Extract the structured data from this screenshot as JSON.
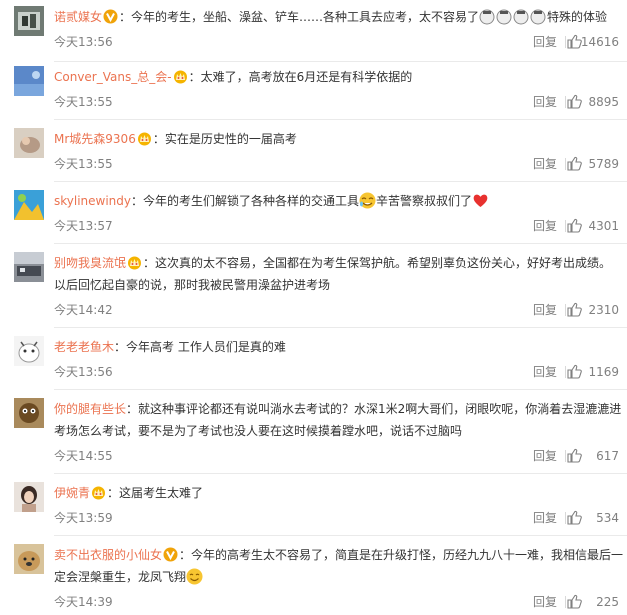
{
  "comments": [
    {
      "username": "诺贰媒女",
      "badge": "v-gold",
      "text": "今年的考生，坐船、澡盆、铲车……各种工具去应考，太不容易了",
      "emoji_text": "特殊的体验",
      "time": "今天13:56",
      "reply_label": "回复",
      "likes": "14616"
    },
    {
      "username": "Conver_Vans_总_会-",
      "badge": "crown",
      "text": "太难了，高考放在6月还是有科学依据的",
      "time": "今天13:55",
      "reply_label": "回复",
      "likes": "8895"
    },
    {
      "username": "Mr城先森9306",
      "badge": "crown",
      "text": "实在是历史性的一届高考",
      "time": "今天13:55",
      "reply_label": "回复",
      "likes": "5789"
    },
    {
      "username": "skylinewindy",
      "badge": "",
      "text": "今年的考生们解锁了各种各样的交通工具",
      "text_after": "辛苦警察叔叔们了",
      "time": "今天13:57",
      "reply_label": "回复",
      "likes": "4301"
    },
    {
      "username": "别吻我臭流氓",
      "badge": "crown",
      "text": "这次真的太不容易，全国都在为考生保驾护航。希望别辜负这份关心，好好考出成绩。以后回忆起自豪的说，那时我被民警用澡盆护进考场",
      "time": "今天14:42",
      "reply_label": "回复",
      "likes": "2310"
    },
    {
      "username": "老老老鱼木",
      "badge": "",
      "text": "今年高考 工作人员们是真的难",
      "time": "今天13:56",
      "reply_label": "回复",
      "likes": "1169"
    },
    {
      "username": "你的腿有些长",
      "badge": "",
      "text": "就这种事评论都还有说叫淌水去考试的？水深1米2啊大哥们，闭眼吹呢，你淌着去湿漉漉进考场怎么考试，要不是为了考试也没人要在这时候摸着蹚水吧，说话不过脑吗",
      "time": "今天14:55",
      "reply_label": "回复",
      "likes": "617"
    },
    {
      "username": "伊婉青",
      "badge": "crown",
      "text": "这届考生太难了",
      "time": "今天13:59",
      "reply_label": "回复",
      "likes": "534"
    },
    {
      "username": "卖不出衣服的小仙女",
      "badge": "v-gold",
      "text": "今年的高考生太不容易了，简直是在升级打怪，历经九九八十一难，我相信最后一定会涅槃重生，龙凤飞翔",
      "time": "今天14:39",
      "reply_label": "回复",
      "likes": "225"
    }
  ],
  "colors": {
    "username": "#eb7350",
    "meta": "#808080",
    "text": "#333333",
    "divider": "#eaeaea"
  }
}
